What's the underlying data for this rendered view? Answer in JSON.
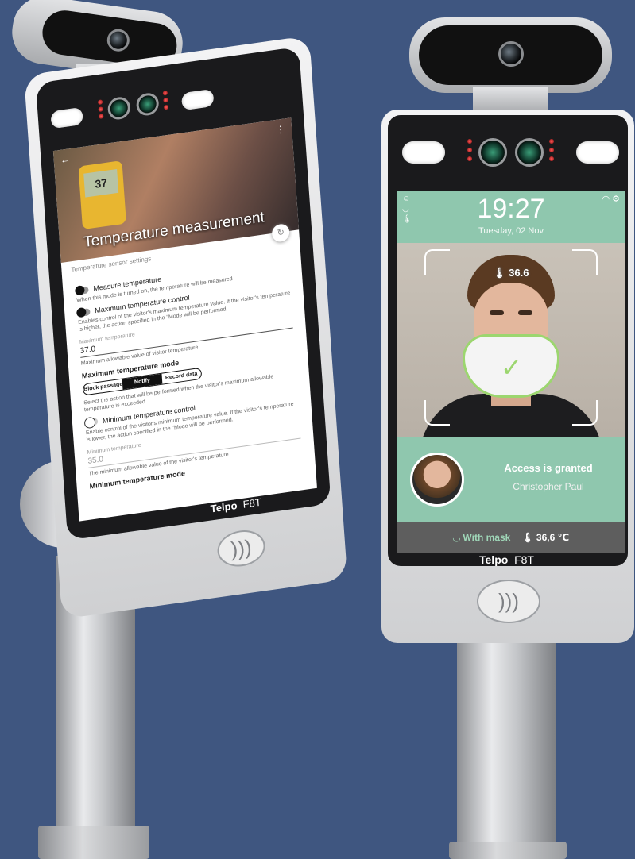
{
  "left_device": {
    "brand": "Telpo",
    "model": "F8T",
    "screen": {
      "back_icon": "arrow-left-icon",
      "menu_icon": "more-vert-icon",
      "hero_thermometer_reading": "37",
      "hero_title": "Temperature measurement",
      "subheader": "Temperature sensor settings",
      "refresh_icon": "refresh-icon",
      "measure_temperature": {
        "label": "Measure temperature",
        "hint": "When this mode is turned on, the temperature will be measured"
      },
      "max_control": {
        "label": "Maximum temperature control",
        "hint": "Enables control of the visitor's maximum temperature value. If the visitor's temperature is higher, the action specified in the \"Mode will be performed."
      },
      "max_temp_field": {
        "label": "Maximum temperature",
        "value": "37.0",
        "hint": "Maximum allowable value of visitor temperature."
      },
      "max_mode": {
        "title": "Maximum temperature mode",
        "options": [
          "Block passage",
          "Notify",
          "Record data"
        ],
        "selected": "Notify",
        "hint": "Select the action that will be performed when the visitor's maximum allowable temperature is exceeded"
      },
      "min_control": {
        "label": "Minimum temperature control",
        "hint": "Enable control of the visitor's minimum temperature value. If the visitor's temperature is lower, the action specified in the \"Mode will be performed."
      },
      "min_temp_field": {
        "label": "Minimum temperature",
        "value": "35.0",
        "hint": "The minimum allowable value of the visitor's temperature"
      },
      "min_mode": {
        "title": "Minimum temperature mode"
      }
    }
  },
  "right_device": {
    "brand": "Telpo",
    "model": "F8T",
    "screen": {
      "time": "19:27",
      "date": "Tuesday, 02 Nov",
      "status_icons_left": [
        "face-icon",
        "mask-icon",
        "thermometer-icon"
      ],
      "status_icons_right": [
        "wifi-icon",
        "gear-icon"
      ],
      "face_temperature": "36.6",
      "access_title": "Access is granted",
      "person_name": "Christopher Paul",
      "mask_status": "With mask",
      "temperature_status": "36,6 ℃"
    }
  }
}
